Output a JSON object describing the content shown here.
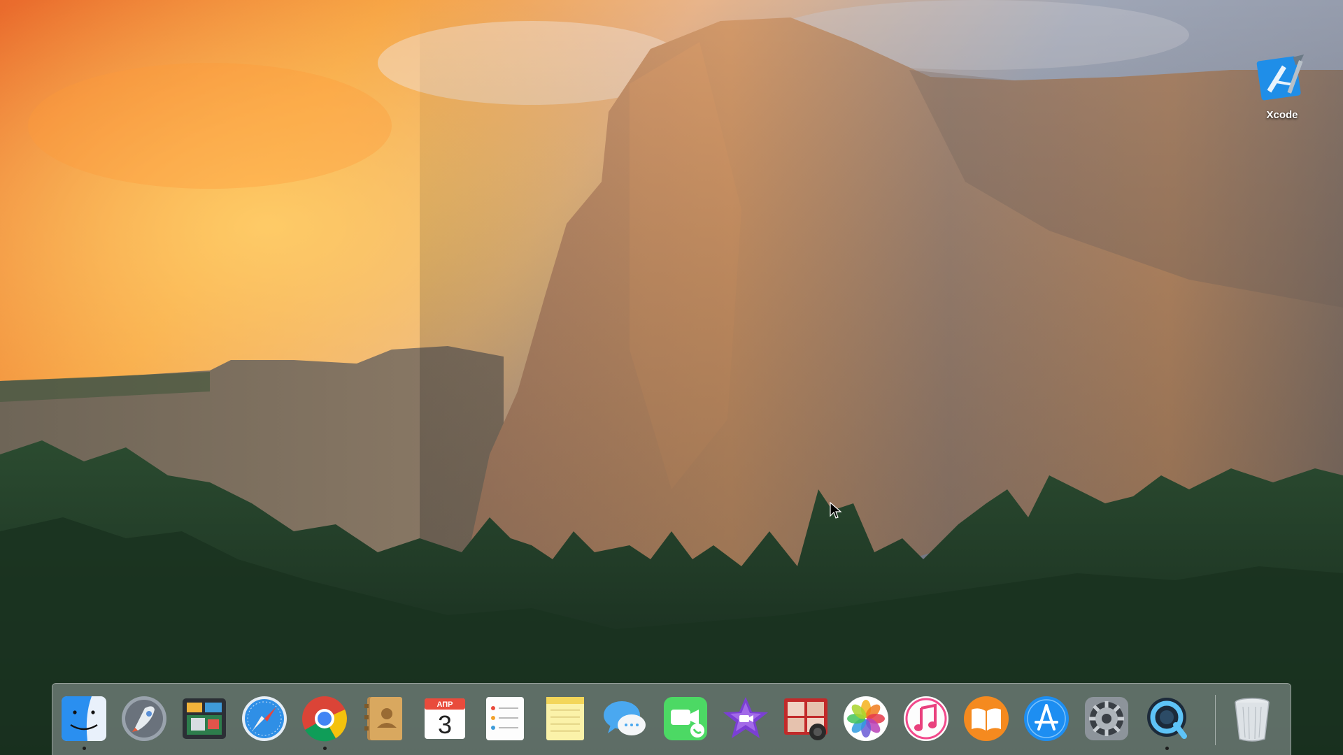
{
  "desktop": {
    "icons": [
      {
        "label": "Xcode",
        "icon": "xcode-icon"
      }
    ]
  },
  "dock": {
    "apps": [
      {
        "icon": "finder-icon",
        "running": true
      },
      {
        "icon": "launchpad-icon",
        "running": false
      },
      {
        "icon": "mission-control-icon",
        "running": false
      },
      {
        "icon": "safari-icon",
        "running": false
      },
      {
        "icon": "chrome-icon",
        "running": true
      },
      {
        "icon": "contacts-icon",
        "running": false
      },
      {
        "icon": "calendar-icon",
        "running": false
      },
      {
        "icon": "reminders-icon",
        "running": false
      },
      {
        "icon": "notes-icon",
        "running": false
      },
      {
        "icon": "messages-icon",
        "running": false
      },
      {
        "icon": "facetime-icon",
        "running": false
      },
      {
        "icon": "imovie-icon",
        "running": false
      },
      {
        "icon": "photo-booth-icon",
        "running": false
      },
      {
        "icon": "photos-icon",
        "running": false
      },
      {
        "icon": "itunes-icon",
        "running": false
      },
      {
        "icon": "ibooks-icon",
        "running": false
      },
      {
        "icon": "app-store-icon",
        "running": false
      },
      {
        "icon": "system-preferences-icon",
        "running": false
      },
      {
        "icon": "quicktime-icon",
        "running": true
      }
    ],
    "calendar": {
      "month": "АПР",
      "day": "3"
    },
    "trash": {
      "icon": "trash-icon"
    }
  },
  "colors": {
    "sky_warm": "#f39a3c",
    "rock": "#c99067",
    "forest": "#1f3d26",
    "dock_glass": "#bec4c8"
  }
}
